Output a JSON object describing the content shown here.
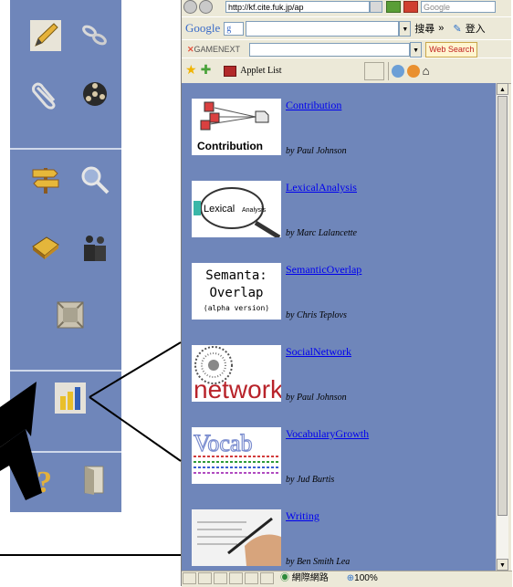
{
  "palette": {
    "tools": [
      {
        "name": "pencil-icon"
      },
      {
        "name": "chain-link-icon"
      },
      {
        "name": "paperclip-icon"
      },
      {
        "name": "film-reel-icon"
      },
      {
        "name": "signpost-icon"
      },
      {
        "name": "magnifier-icon"
      },
      {
        "name": "book-icon"
      },
      {
        "name": "people-icon"
      },
      {
        "name": "frame-icon"
      },
      {
        "name": "bar-chart-icon"
      },
      {
        "name": "question-icon"
      },
      {
        "name": "door-icon"
      }
    ]
  },
  "browser": {
    "address": "http://kf.cite.fuk.jp/ap",
    "search_placeholder": "Google",
    "google_logo": "Google",
    "google_g": "g",
    "search_label": "搜尋",
    "more_label": "»",
    "login_label": "登入",
    "game_logo": "GAMENEXT",
    "web_search": "Web Search",
    "tab_label": "Applet List",
    "status_zone": "網際網路",
    "zoom": "100%"
  },
  "applets": [
    {
      "title": "Contribution",
      "author": "by Paul Johnson",
      "thumb": "contribution"
    },
    {
      "title": "LexicalAnalysis",
      "author": "by Marc Lalancette",
      "thumb": "lexical"
    },
    {
      "title": "SemanticOverlap",
      "author": "by Chris Teplovs",
      "thumb": "semanta"
    },
    {
      "title": "SocialNetwork",
      "author": "by Paul Johnson",
      "thumb": "network"
    },
    {
      "title": "VocabularyGrowth",
      "author": "by Jud Burtis",
      "thumb": "vocab"
    },
    {
      "title": "Writing",
      "author": "by Ben Smith Lea",
      "thumb": "writing"
    }
  ],
  "thumb_text": {
    "contribution": "Contribution",
    "lexical_1": "Lexical",
    "lexical_2": "Analysis",
    "semanta_1": "Semanta:",
    "semanta_2": "Overlap",
    "semanta_3": "(alpha version)",
    "network": "network",
    "vocab": "Vocab"
  }
}
